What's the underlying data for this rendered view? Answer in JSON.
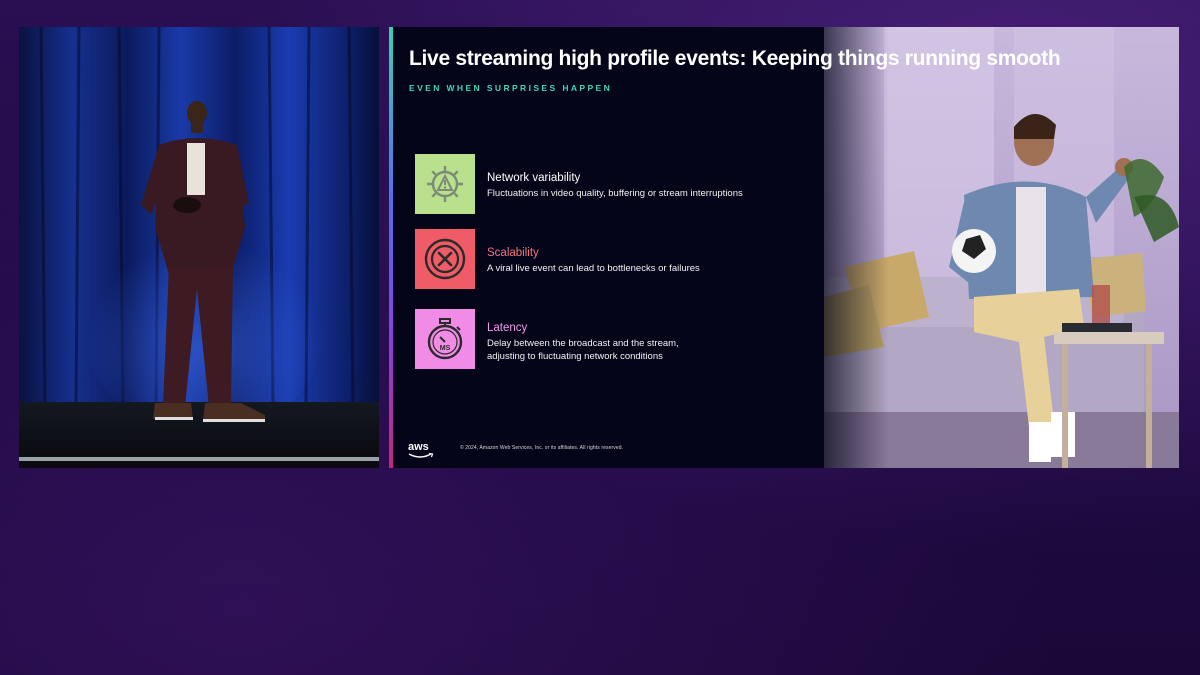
{
  "slide": {
    "title": "Live streaming high profile events: Keeping things running smooth",
    "subtitle": "EVEN WHEN SURPRISES HAPPEN",
    "items": [
      {
        "title": "Network variability",
        "description": "Fluctuations in video quality, buffering or stream interruptions",
        "icon": "gear-warning-icon",
        "icon_bg": "#b9e08c",
        "title_color": "#ffffff"
      },
      {
        "title": "Scalability",
        "description": "A viral live event can lead to bottlenecks or failures",
        "icon": "x-circle-icon",
        "icon_bg": "#ef5b66",
        "title_color": "#f27380"
      },
      {
        "title": "Latency",
        "description_line1": "Delay between the broadcast and the stream,",
        "description_line2": "adjusting to fluctuating network conditions",
        "icon": "stopwatch-icon",
        "icon_label": "MS",
        "icon_bg": "#f08ce6",
        "title_color": "#f49be9"
      }
    ],
    "footer": {
      "logo": "aws",
      "copyright": "© 2024, Amazon Web Services, Inc. or its affiliates. All rights reserved."
    }
  },
  "colors": {
    "background": "#200a45",
    "slide_background": "#05051a",
    "subtitle_accent": "#3fd6b4"
  }
}
